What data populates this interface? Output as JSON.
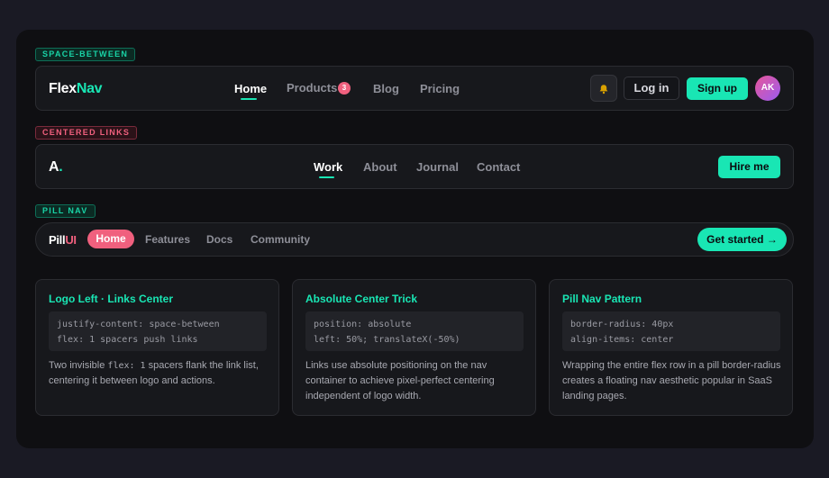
{
  "sections": {
    "s1": {
      "tag": "SPACE-BETWEEN"
    },
    "s2": {
      "tag": "CENTERED LINKS"
    },
    "s3": {
      "tag": "PILL NAV"
    }
  },
  "nav1": {
    "brand_a": "Flex",
    "brand_b": "Nav",
    "links": [
      "Home",
      "Products",
      "Blog",
      "Pricing"
    ],
    "products_badge": "3",
    "bell_icon": "bell-icon",
    "login": "Log in",
    "signup": "Sign up",
    "avatar": "AK"
  },
  "nav2": {
    "brand_a": "A",
    "brand_b": ".",
    "links": [
      "Work",
      "About",
      "Journal",
      "Contact"
    ],
    "cta": "Hire me"
  },
  "nav3": {
    "brand_a": "Pill",
    "brand_b": "UI",
    "links": [
      "Home",
      "Features",
      "Docs",
      "Community"
    ],
    "cta": "Get started →"
  },
  "cards": [
    {
      "title": "Logo Left · Links Center",
      "code1": "justify-content: space-between",
      "code2": "flex: 1 spacers push links",
      "desc_a": "Two invisible ",
      "desc_mono": "flex: 1",
      "desc_b": " spacers flank the link list, centering it between logo and actions."
    },
    {
      "title": "Absolute Center Trick",
      "code1": "position: absolute",
      "code2": "left: 50%; translateX(-50%)",
      "desc": "Links use absolute positioning on the nav container to achieve pixel-perfect centering independent of logo width."
    },
    {
      "title": "Pill Nav Pattern",
      "code1": "border-radius: 40px",
      "code2": "align-items: center",
      "desc": "Wrapping the entire flex row in a pill border-radius creates a floating nav aesthetic popular in SaaS landing pages."
    }
  ],
  "colors": {
    "accent": "#19e6b4",
    "pink": "#f0607e",
    "panel": "#0f0f12"
  }
}
